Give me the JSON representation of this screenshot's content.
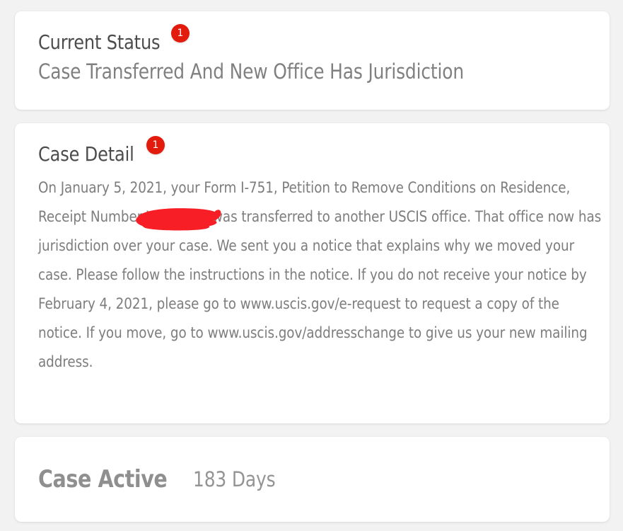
{
  "status_card": {
    "label": "Current Status",
    "badge": "1",
    "value": "Case Transferred And New Office Has Jurisdiction"
  },
  "detail_card": {
    "label": "Case Detail",
    "badge": "1",
    "text_before_redaction": "On January 5, 2021, your Form I-751, Petition to Remove Conditions on Residence, Receipt Number W",
    "redacted_placeholder": "",
    "text_after_redaction": "7, was transferred to another USCIS office. That office now has jurisdiction over your case. We sent you a notice that explains why we moved your case. Please follow the instructions in the notice. If you do not receive your notice by February 4, 2021, please go to www.uscis.gov/e-request to request a copy of the notice. If you move, go to www.uscis.gov/addresschange to give us your new mailing address.",
    "full_text": "On January 5, 2021, your Form I-751, Petition to Remove Conditions on Residence, Receipt Number W█████████7, was transferred to another USCIS office. That office now has jurisdiction over your case. We sent you a notice that explains why we moved your case. Please follow the instructions in the notice. If you do not receive your notice by February 4, 2021, please go to www.uscis.gov/e-request to request a copy of the notice. If you move, go to www.uscis.gov/addresschange to give us your new mailing address."
  },
  "active_card": {
    "title": "Case Active",
    "days": "183 Days"
  },
  "colors": {
    "badge_red": "#e31b0c",
    "redaction_red": "#f71e25",
    "page_background": "#f2f2f2",
    "card_background": "#ffffff",
    "label_text": "#4c4c4c",
    "body_text": "#7d7d7d"
  }
}
